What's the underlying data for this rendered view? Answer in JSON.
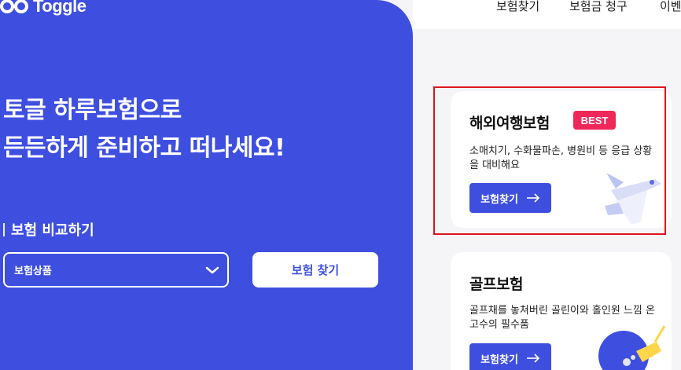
{
  "brand": {
    "name": "Toggle"
  },
  "nav": {
    "items": [
      "보험찾기",
      "보험금 청구",
      "이벤"
    ]
  },
  "hero": {
    "headline_line1": "토글 하루보험으로",
    "headline_line2": "든든하게 준비하고 떠나세요!",
    "compare_label": "보험 비교하기",
    "select_value": "보험상품",
    "find_button": "보험 찾기"
  },
  "cards": [
    {
      "title": "해외여행보험",
      "badge": "BEST",
      "desc": "소매치기, 수화물파손, 병원비 등 응급 상황을 대비해요",
      "button": "보험찾기"
    },
    {
      "title": "골프보험",
      "desc": "골프채를 놓쳐버린 골린이와 홀인원 느낌 온 고수의 필수품",
      "button": "보험찾기"
    }
  ],
  "colors": {
    "primary": "#3e4fe0",
    "badge": "#f0285a",
    "highlight": "#e0141e"
  }
}
